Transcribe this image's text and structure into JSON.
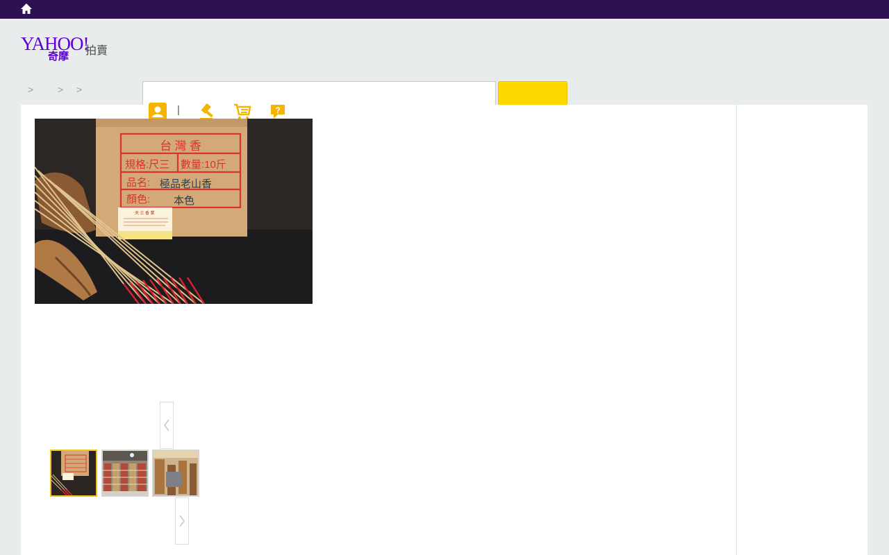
{
  "topbar": {
    "home_icon": "home-icon"
  },
  "logo": {
    "brand": "YAHOO!",
    "sub": "奇摩",
    "section": "拍賣"
  },
  "breadcrumb": {
    "separators": [
      ">",
      ">",
      ">"
    ]
  },
  "search": {
    "input_value": "",
    "placeholder": "",
    "button_label": ""
  },
  "utility_icons": [
    "user-icon",
    "gavel-icon",
    "cart-icon",
    "help-icon"
  ],
  "utility_separator": "|",
  "hero_image": {
    "box_title": "台 灣 香",
    "row1_a": "規格:尺三",
    "row1_b": "數量:10斤",
    "row2": "品名:",
    "row2_hand": "極品老山香",
    "row3": "顏色:",
    "row3_hand": "本色",
    "card_text": "天 三 香 業"
  },
  "gallery": {
    "prev_icon": "chevron-left-icon",
    "next_icon": "chevron-right-icon",
    "thumbnails": [
      "thumbnail-incense-box",
      "thumbnail-shop-shelves",
      "thumbnail-wood-stacks"
    ],
    "active_index": 0
  },
  "colors": {
    "topbar": "#2d1152",
    "brand_purple": "#5f01d1",
    "accent_yellow": "#ffd800",
    "icon_yellow": "#f4b400",
    "page_bg": "#e8eced"
  }
}
